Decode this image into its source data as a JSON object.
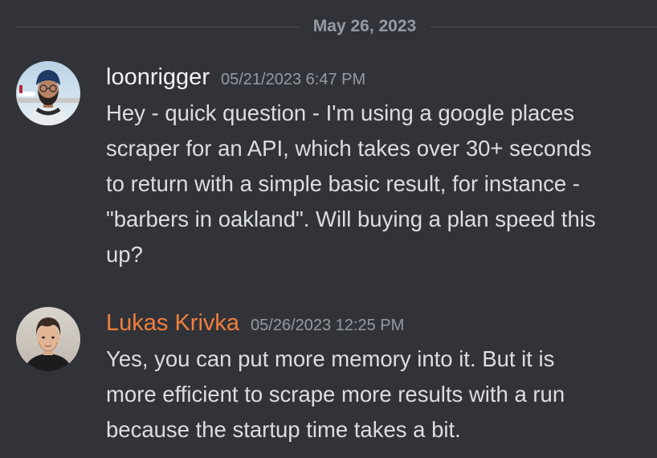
{
  "date_divider": "May 26, 2023",
  "messages": [
    {
      "username": "loonrigger",
      "timestamp": "05/21/2023 6:47 PM",
      "lines": [
        "Hey - quick question - I'm using a google places",
        "scraper for an API, which takes over 30+ seconds",
        "to return with a simple basic result, for instance -",
        "\"barbers in oakland\". Will buying a plan speed this",
        "up?"
      ]
    },
    {
      "username": "Lukas Krivka",
      "username_color": "#f07f3c",
      "timestamp": "05/26/2023 12:25 PM",
      "lines": [
        "Yes, you can put more memory into it. But it is",
        "more efficient to scrape more results with a run",
        "because the startup time takes a bit."
      ]
    }
  ],
  "colors": {
    "background": "#313338",
    "text": "#dbdee1",
    "muted": "#949ba4",
    "divider": "#4e5058",
    "username_default": "#f2f3f5",
    "username_accent": "#f07f3c"
  }
}
